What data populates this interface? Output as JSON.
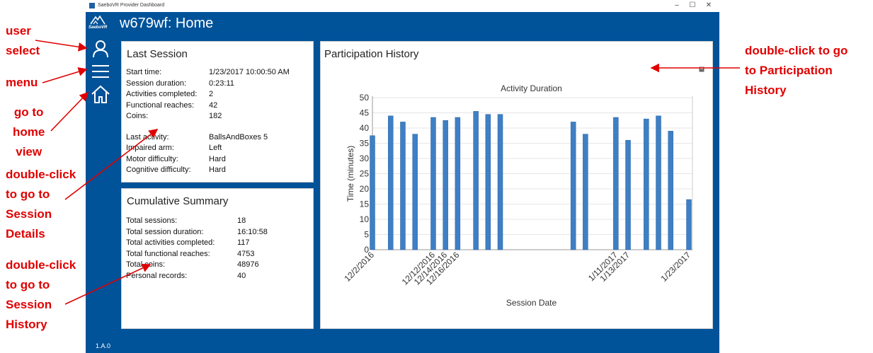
{
  "window": {
    "title_bar": "SaeboVR Provider Dashboard",
    "min": "–",
    "max": "☐",
    "close": "✕"
  },
  "header": {
    "logo_text": "SaeboVR",
    "page_title": "w679wf: Home"
  },
  "sidebar": {
    "items": [
      {
        "icon": "user-icon"
      },
      {
        "icon": "menu-icon"
      },
      {
        "icon": "home-icon"
      }
    ],
    "version": "1.A.0"
  },
  "last_session": {
    "title": "Last Session",
    "rows": [
      {
        "label": "Start time:",
        "value": "1/23/2017 10:00:50 AM"
      },
      {
        "label": "Session duration:",
        "value": "0:23:11"
      },
      {
        "label": "Activities completed:",
        "value": "2"
      },
      {
        "label": "Functional reaches:",
        "value": "42"
      },
      {
        "label": "Coins:",
        "value": "182"
      }
    ],
    "rows2": [
      {
        "label": "Last activity:",
        "value": "BallsAndBoxes 5"
      },
      {
        "label": "Impaired arm:",
        "value": "Left"
      },
      {
        "label": "Motor difficulty:",
        "value": "Hard"
      },
      {
        "label": "Cognitive difficulty:",
        "value": "Hard"
      }
    ]
  },
  "cumulative": {
    "title": "Cumulative Summary",
    "rows": [
      {
        "label": "Total sessions:",
        "value": "18"
      },
      {
        "label": "Total session duration:",
        "value": "16:10:58"
      },
      {
        "label": "Total activities completed:",
        "value": "117"
      },
      {
        "label": "Total functional reaches:",
        "value": "4753"
      },
      {
        "label": "Total coins:",
        "value": "48976"
      },
      {
        "label": "Personal records:",
        "value": "40"
      }
    ]
  },
  "participation": {
    "title": "Participation History",
    "save_icon": "save-icon"
  },
  "annotations": {
    "user_select": "user\nselect",
    "menu": "menu",
    "home": "go to\nhome\nview",
    "session_details": "double-click\nto go to\nSession\nDetails",
    "session_history": "double-click\nto go to\nSession\nHistory",
    "participation": "double-click to go\nto Participation\nHistory"
  },
  "colors": {
    "app_blue": "#005299",
    "bar_blue": "#3f7fc4",
    "annotation_red": "#e00000"
  },
  "chart_data": {
    "type": "bar",
    "title": "Activity Duration",
    "xlabel": "Session Date",
    "ylabel": "Time (minutes)",
    "ylim": [
      0,
      50
    ],
    "yticks": [
      0,
      5,
      10,
      15,
      20,
      25,
      30,
      35,
      40,
      45,
      50
    ],
    "x_range": [
      "12/2/2016",
      "1/23/2017"
    ],
    "xtick_labels": [
      "12/2/2016",
      "12/12/2016",
      "12/14/2016",
      "12/16/2016",
      "1/11/2017",
      "1/13/2017",
      "1/23/2017"
    ],
    "bars": [
      {
        "date": "12/2/2016",
        "value": 37.5
      },
      {
        "date": "12/5/2016",
        "value": 44
      },
      {
        "date": "12/7/2016",
        "value": 42
      },
      {
        "date": "12/9/2016",
        "value": 38
      },
      {
        "date": "12/12/2016",
        "value": 43.5
      },
      {
        "date": "12/14/2016",
        "value": 42.5
      },
      {
        "date": "12/16/2016",
        "value": 43.5
      },
      {
        "date": "12/19/2016",
        "value": 45.5
      },
      {
        "date": "12/21/2016",
        "value": 44.5
      },
      {
        "date": "12/23/2016",
        "value": 44.5
      },
      {
        "date": "1/4/2017",
        "value": 42
      },
      {
        "date": "1/6/2017",
        "value": 38
      },
      {
        "date": "1/11/2017",
        "value": 43.5
      },
      {
        "date": "1/13/2017",
        "value": 36
      },
      {
        "date": "1/16/2017",
        "value": 43
      },
      {
        "date": "1/18/2017",
        "value": 44
      },
      {
        "date": "1/20/2017",
        "value": 39
      },
      {
        "date": "1/23/2017",
        "value": 16.5
      }
    ],
    "grid": true,
    "legend": "none"
  }
}
